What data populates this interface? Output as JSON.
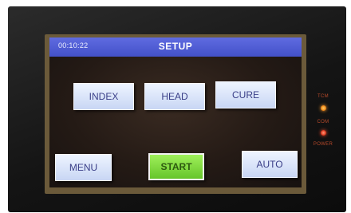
{
  "header": {
    "clock": "00:10:22",
    "title": "SETUP"
  },
  "buttons": {
    "index": "INDEX",
    "head": "HEAD",
    "cure": "CURE",
    "menu": "MENU",
    "start": "START",
    "auto": "AUTO"
  },
  "indicators": {
    "tcm": "TCM",
    "com": "COM",
    "power": "POWER"
  },
  "colors": {
    "title_bar": "#4f5cd6",
    "start_button": "#7ed63a",
    "led_amber": "#f08a1a",
    "led_red": "#e03a20"
  }
}
